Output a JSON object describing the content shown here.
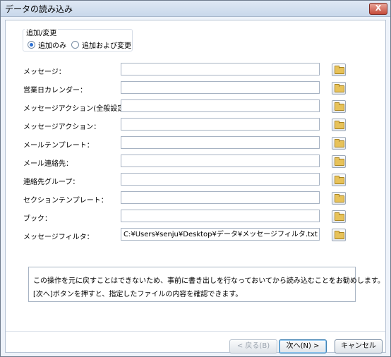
{
  "window": {
    "title": "データの読み込み",
    "close_glyph": "X"
  },
  "mode": {
    "legend": "追加/変更",
    "options": [
      {
        "label": "追加のみ",
        "selected": true
      },
      {
        "label": "追加および変更",
        "selected": false
      }
    ]
  },
  "rows": [
    {
      "label": "メッセージ：",
      "value": ""
    },
    {
      "label": "営業日カレンダー：",
      "value": ""
    },
    {
      "label": "メッセージアクション(全般設定)：",
      "value": ""
    },
    {
      "label": "メッセージアクション：",
      "value": ""
    },
    {
      "label": "メールテンプレート：",
      "value": ""
    },
    {
      "label": "メール連絡先：",
      "value": ""
    },
    {
      "label": "連絡先グループ：",
      "value": ""
    },
    {
      "label": "セクションテンプレート：",
      "value": ""
    },
    {
      "label": "ブック：",
      "value": ""
    },
    {
      "label": "メッセージフィルタ：",
      "value": "C:¥Users¥senju¥Desktop¥データ¥メッセージフィルタ.txt"
    }
  ],
  "note": {
    "line1": "この操作を元に戻すことはできないため、事前に書き出しを行なっておいてから読み込むことをお勧めします。",
    "line2": "[次へ]ボタンを押すと、指定したファイルの内容を確認できます。"
  },
  "buttons": {
    "back": "< 戻る(B)",
    "next": "次へ(N) >",
    "cancel": "キャンセル"
  },
  "icons": {
    "browse": "folder-icon",
    "close": "close-icon"
  }
}
